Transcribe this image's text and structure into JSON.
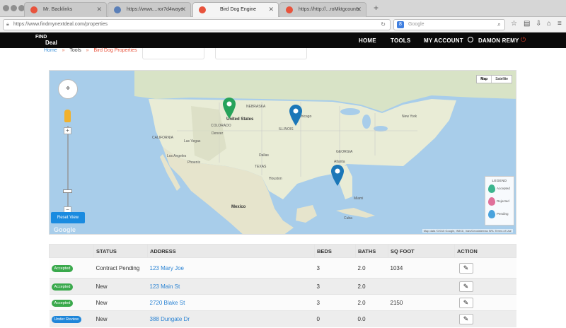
{
  "browser": {
    "tabs": [
      {
        "label": "Mr. Backlinks",
        "active": false
      },
      {
        "label": "https://www....ror7d4waye",
        "active": false
      },
      {
        "label": "Bird Dog Engine",
        "active": true
      },
      {
        "label": "https://http://...roMktgcounts",
        "active": false
      }
    ],
    "url": "https://www.findmynextdeal.com/properties",
    "search_placeholder": "Google"
  },
  "site": {
    "logo": {
      "line1": "FIND",
      "line2": "Deal"
    },
    "nav": {
      "home": "HOME",
      "tools": "TOOLS",
      "account": "MY ACCOUNT",
      "user": "DAMON REMY"
    }
  },
  "breadcrumb": {
    "home": "Home",
    "tools": "Tools",
    "current": "Bird Dog Properties",
    "sep": "»"
  },
  "map": {
    "type_buttons": [
      "Map",
      "Satellite"
    ],
    "reset_label": "Reset View",
    "brand": "Google",
    "attribution": "Map data ©2015 Google, INEGI, Inav/Geosistemas SRL   Terms of Use",
    "labels": {
      "usa": "United States",
      "mexico": "Mexico",
      "cuba": "Cuba",
      "nebraska": "NEBRASKA",
      "illinois": "ILLINOIS",
      "colorado": "COLORADO",
      "california": "CALIFORNIA",
      "texas": "TEXAS",
      "georgia": "GEORGIA",
      "vegas": "Las Vegas",
      "la": "Los Angeles",
      "dallas": "Dallas",
      "houston": "Houston",
      "atlanta": "Atlanta",
      "chicago": "Chicago",
      "ny": "New York",
      "denver": "Denver",
      "phoenix": "Phoenix",
      "miami": "Miami"
    },
    "markers": [
      {
        "status": "Accepted",
        "color": "#27a35a"
      },
      {
        "status": "Pending",
        "color": "#1b77b8"
      },
      {
        "status": "Pending",
        "color": "#1b77b8"
      }
    ],
    "legend": {
      "title": "LEGEND",
      "items": [
        {
          "label": "Accepted",
          "color": "#3bb58e"
        },
        {
          "label": "Rejected",
          "color": "#e0709a"
        },
        {
          "label": "Pending",
          "color": "#4aa3dd"
        }
      ]
    }
  },
  "table": {
    "headers": [
      "",
      "STATUS",
      "ADDRESS",
      "BEDS",
      "BATHS",
      "SQ FOOT",
      "ACTION"
    ],
    "rows": [
      {
        "badge": "Accepted",
        "badge_color": "#3aa94c",
        "status": "Contract Pending",
        "address": "123 Mary Joe",
        "beds": "3",
        "baths": "2.0",
        "sqft": "1034"
      },
      {
        "badge": "Accepted",
        "badge_color": "#3aa94c",
        "status": "New",
        "address": "123 Main St",
        "beds": "3",
        "baths": "2.0",
        "sqft": ""
      },
      {
        "badge": "Accepted",
        "badge_color": "#3aa94c",
        "status": "New",
        "address": "2720 Blake St",
        "beds": "3",
        "baths": "2.0",
        "sqft": "2150"
      },
      {
        "badge": "Under Review",
        "badge_color": "#1f86d9",
        "status": "New",
        "address": "388 Dungate Dr",
        "beds": "0",
        "baths": "0.0",
        "sqft": ""
      }
    ]
  }
}
